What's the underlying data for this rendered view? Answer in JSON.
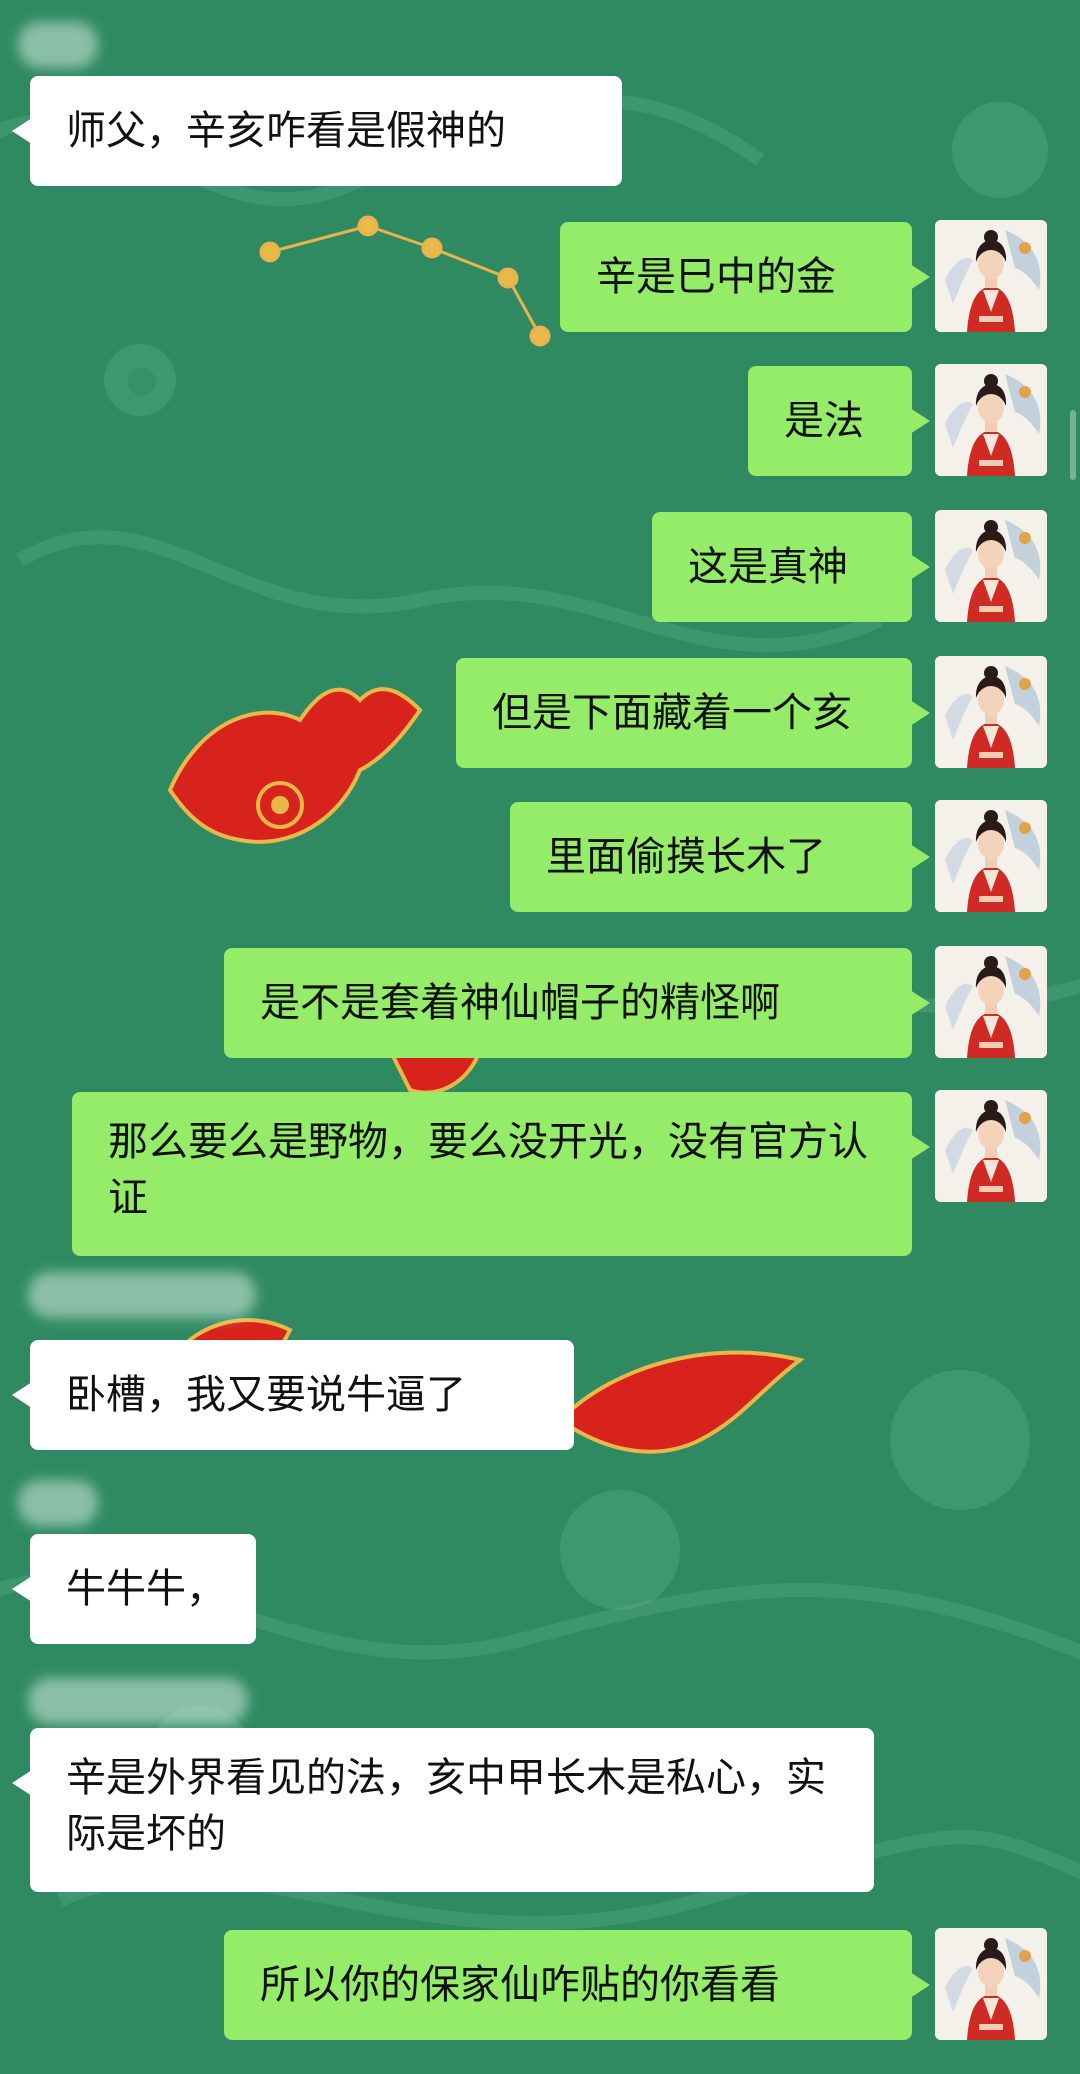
{
  "messages": [
    {
      "side": "in",
      "text": "师父，辛亥咋看是假神的"
    },
    {
      "side": "out",
      "text": "辛是巳中的金"
    },
    {
      "side": "out",
      "text": "是法"
    },
    {
      "side": "out",
      "text": "这是真神"
    },
    {
      "side": "out",
      "text": "但是下面藏着一个亥"
    },
    {
      "side": "out",
      "text": "里面偷摸长木了"
    },
    {
      "side": "out",
      "text": "是不是套着神仙帽子的精怪啊"
    },
    {
      "side": "out",
      "text": "那么要么是野物，要么没开光，没有官方认证"
    },
    {
      "side": "in",
      "text": "卧槽，我又要说牛逼了"
    },
    {
      "side": "in",
      "text": "牛牛牛，"
    },
    {
      "side": "in",
      "text": "辛是外界看见的法，亥中甲长木是私心，实际是坏的"
    },
    {
      "side": "out",
      "text": "所以你的保家仙咋贴的你看看"
    }
  ],
  "colors": {
    "background": "#2f8a62",
    "incoming_bubble": "#ffffff",
    "outgoing_bubble": "#95ec69"
  },
  "avatar_icon": "avatar-woman-red-robe-icon"
}
